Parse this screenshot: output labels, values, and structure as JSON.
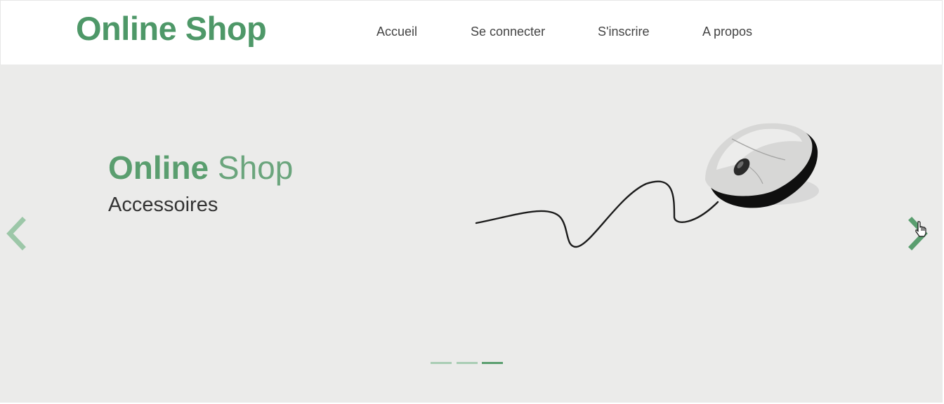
{
  "header": {
    "logo": "Online Shop",
    "nav": [
      {
        "label": "Accueil"
      },
      {
        "label": "Se connecter"
      },
      {
        "label": "S'inscrire"
      },
      {
        "label": "A propos"
      }
    ]
  },
  "hero": {
    "title_bold": "Online",
    "title_light": "Shop",
    "subtitle": "Accessoires",
    "image_icon": "computer-mouse-image",
    "prev_icon": "chevron-left-icon",
    "next_icon": "chevron-right-icon"
  },
  "carousel": {
    "slide_count": 3,
    "active_index": 2
  },
  "colors": {
    "brand": "#4e9868",
    "hero_bg": "#ebebea",
    "nav_text": "#444444",
    "indicator_inactive": "#a9cdb4",
    "indicator_active": "#5a9e6f"
  }
}
